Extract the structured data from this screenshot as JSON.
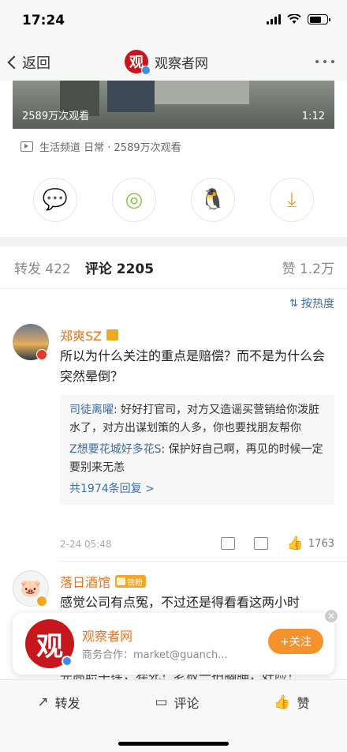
{
  "status_bar": {
    "time": "17:24"
  },
  "nav": {
    "back_label": "返回",
    "title": "观察者网",
    "avatar_text": "观"
  },
  "video": {
    "views_overlay": "2589万次观看",
    "duration": "1:12",
    "channel_info": "生活频道 日常 · 2589万次观看"
  },
  "share_buttons": [
    {
      "icon": "wechat-icon",
      "glyph": "💬",
      "color": "#4caf50"
    },
    {
      "icon": "moments-icon",
      "glyph": "◎",
      "color": "#8bc34a"
    },
    {
      "icon": "qq-icon",
      "glyph": "🐧",
      "color": "#2196f3"
    },
    {
      "icon": "save-image-icon",
      "glyph": "⤓",
      "color": "#f5a623"
    }
  ],
  "tabs": {
    "repost": "转发 422",
    "comment": "评论 2205",
    "like": "赞 1.2万"
  },
  "sort_label": "按热度",
  "comments": [
    {
      "name": "郑爽SZ",
      "text": "所以为什么关注的重点是赔偿？而不是为什么会突然晕倒？",
      "replies": [
        {
          "name": "司徒离曜",
          "text": ": 好好打官司，对方又造谣买营销给你泼脏水了，对方出谋划策的人多，你也要找朋友帮你"
        },
        {
          "name": "Z想要花城好多花S",
          "text": ": 保护好自己啊，再见的时候一定要别来无恙"
        }
      ],
      "replies_more": "共1974条回复 >",
      "timestamp": "2-24 05:48",
      "likes": "1763"
    },
    {
      "name": "落日酒馆",
      "fan_tag": "铁粉",
      "text": "感觉公司有点冤，不过还是得看看这两小时"
    }
  ],
  "promo": {
    "name": "观察者网",
    "desc": "商务合作：market@guanch...",
    "follow_label": "+关注",
    "close_glyph": "✕"
  },
  "peek_text": "完高职手续，猝死！老板一拍胸脯，好险！",
  "bottom_bar": {
    "repost": "转发",
    "comment": "评论",
    "like": "赞"
  }
}
